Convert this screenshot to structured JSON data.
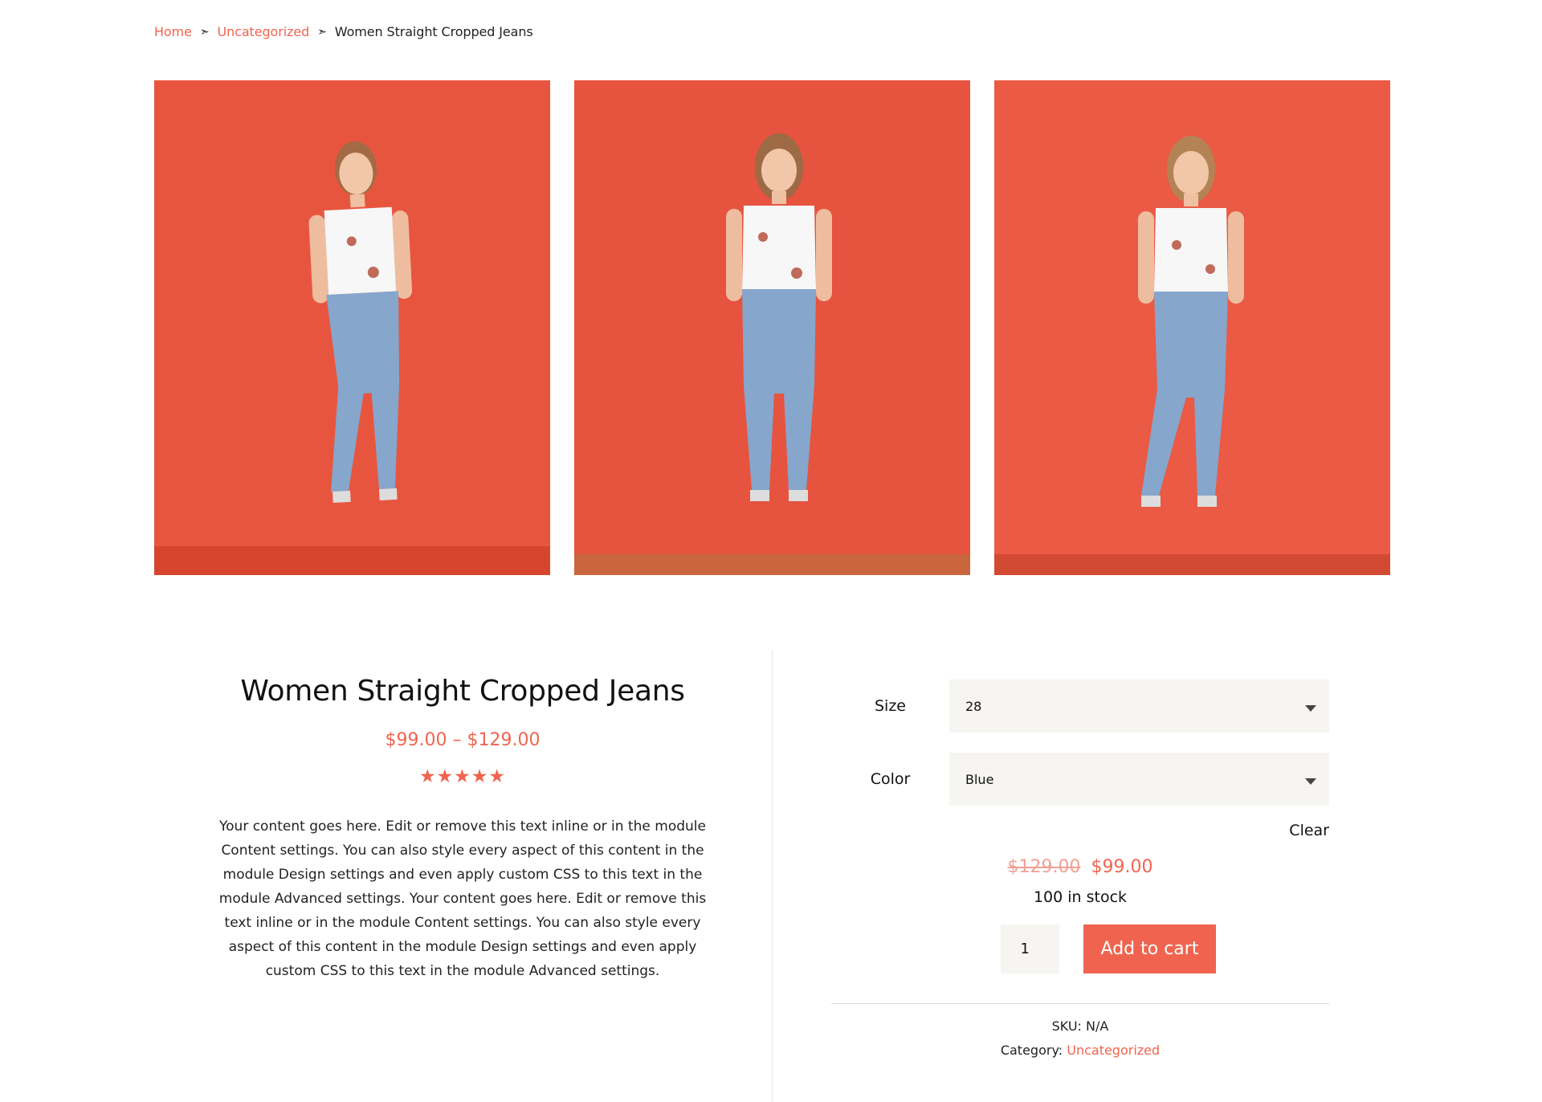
{
  "breadcrumb": {
    "home": "Home",
    "category": "Uncategorized",
    "separator": "➣",
    "current": "Women Straight Cropped Jeans"
  },
  "gallery": {
    "images": [
      "product-photo",
      "product-photo",
      "product-photo"
    ]
  },
  "product": {
    "title": "Women Straight Cropped Jeans",
    "price_range": "$99.00 – $129.00",
    "rating_stars": "★★★★★",
    "description": "Your content goes here. Edit or remove this text inline or in the module Content settings. You can also style every aspect of this content in the module Design settings and even apply custom CSS to this text in the module Advanced settings. Your content goes here. Edit or remove this text inline or in the module Content settings. You can also style every aspect of this content in the module Design settings and even apply custom CSS to this text in the module Advanced settings."
  },
  "form": {
    "size_label": "Size",
    "size_value": "28",
    "color_label": "Color",
    "color_value": "Blue",
    "clear_label": "Clear",
    "old_price": "$129.00",
    "new_price": "$99.00",
    "stock": "100 in stock",
    "quantity": "1",
    "add_to_cart": "Add to cart",
    "sku_label": "SKU:",
    "sku_value": "N/A",
    "category_label": "Category:",
    "category_value": "Uncategorized"
  },
  "colors": {
    "accent": "#f0644f",
    "backdrop": "#e6533f"
  }
}
